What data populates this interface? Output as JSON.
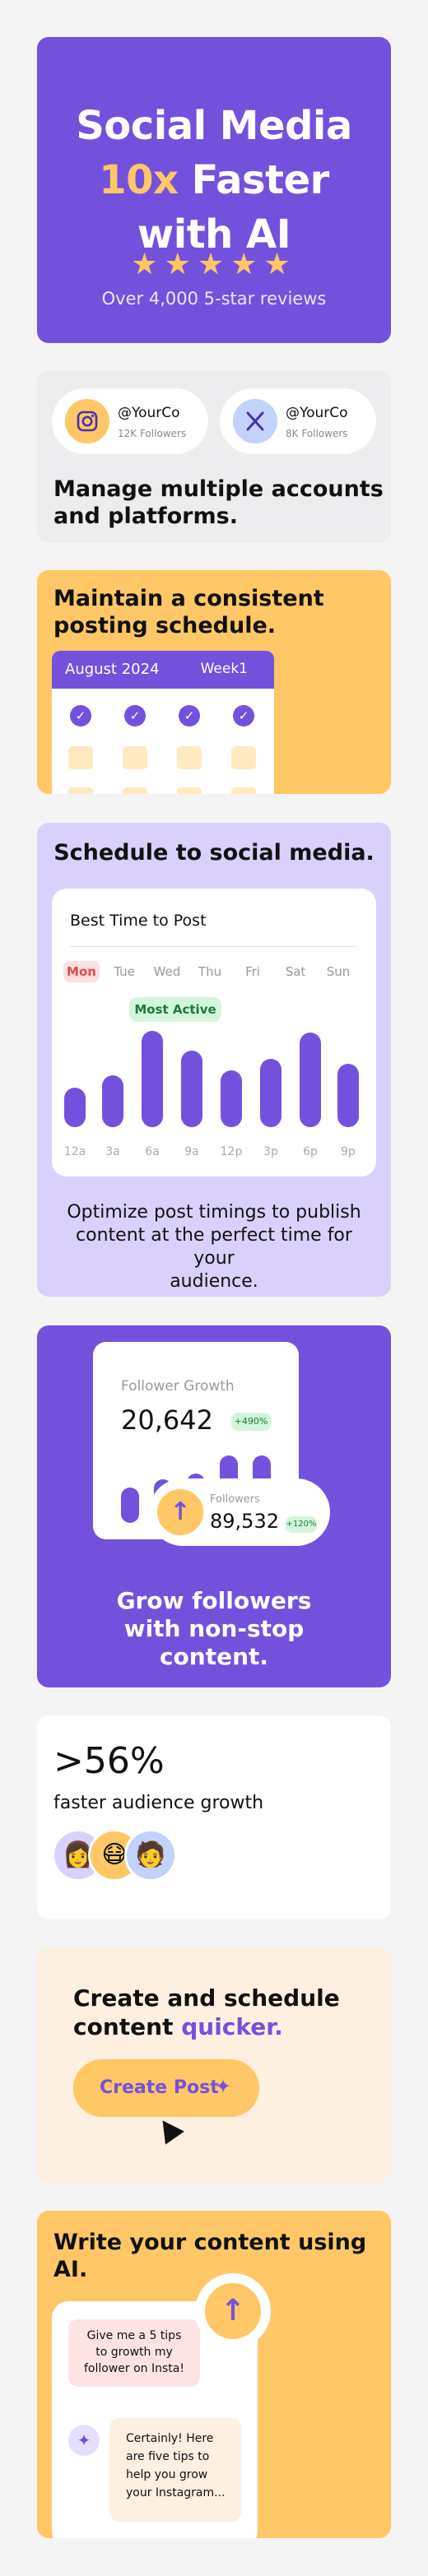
{
  "hero": {
    "line1": "Social Media",
    "line2_accent": "10x",
    "line2_rest": " Faster",
    "line3": "with AI",
    "stars": "★★★★★",
    "reviews": "Over 4,000 5-star reviews"
  },
  "accounts": {
    "instagram": {
      "handle": "@YourCo",
      "followers": "12K Followers",
      "icon": "instagram-icon"
    },
    "twitter": {
      "handle": "@YourCo",
      "followers": "8K Followers",
      "icon": "x-icon"
    },
    "heading_l1": "Manage multiple accounts",
    "heading_l2": "and platforms."
  },
  "schedule": {
    "heading_l1": "Maintain a consistent",
    "heading_l2": "posting schedule.",
    "month": "August 2024",
    "week": "Week1",
    "check": "✓"
  },
  "besttime": {
    "heading": "Schedule to social media.",
    "panel_title": "Best Time to Post",
    "days": [
      "Mon",
      "Tue",
      "Wed",
      "Thu",
      "Fri",
      "Sat",
      "Sun"
    ],
    "active_label": "Most Active",
    "times": [
      "12a",
      "3a",
      "6a",
      "9a",
      "12p",
      "3p",
      "6p",
      "9p"
    ],
    "bars": [
      0.38,
      0.5,
      0.93,
      0.74,
      0.55,
      0.66,
      0.91,
      0.61
    ],
    "desc_l1": "Optimize post timings to publish",
    "desc_l2": "content at the perfect time for your",
    "desc_l3": "audience."
  },
  "growth": {
    "label": "Follower Growth",
    "value": "20,642",
    "badge": "+490%",
    "bars": [
      0.45,
      0.55,
      0.62,
      0.85,
      0.85
    ],
    "followers_label": "Followers",
    "followers_value": "89,532",
    "followers_badge": "+120%",
    "arrow": "↑",
    "text_l1": "Grow followers",
    "text_l2": "with non-stop",
    "text_l3": "content."
  },
  "stat": {
    "value": ">56%",
    "sub": "faster audience growth",
    "avatars": [
      "👩",
      "😷",
      "🧑"
    ],
    "avatar_colors": [
      "#dad0fc",
      "#ffc765",
      "#c3d2fb"
    ]
  },
  "create": {
    "heading_l1": "Create and schedule",
    "heading_l2_a": "content ",
    "heading_l2_b": "quicker.",
    "button": "Create Post",
    "sparkle": "✦"
  },
  "ai": {
    "heading_l1": "Write your content using",
    "heading_l2": "AI.",
    "prompt_l1": "Give me a 5 tips",
    "prompt_l2": "to growth my",
    "prompt_l3": "follower on Insta!",
    "reply_l1": "Certainly! Here",
    "reply_l2": "are five tips to",
    "reply_l3": "help you grow",
    "reply_l4": "your Instagram...",
    "user_avatar": "👩",
    "sparkle": "✦",
    "arrow": "↑"
  },
  "colors": {
    "purple": "#7451dd",
    "yellow": "#ffc765",
    "lavender": "#dad0fc",
    "cream": "#fdf0e1"
  }
}
